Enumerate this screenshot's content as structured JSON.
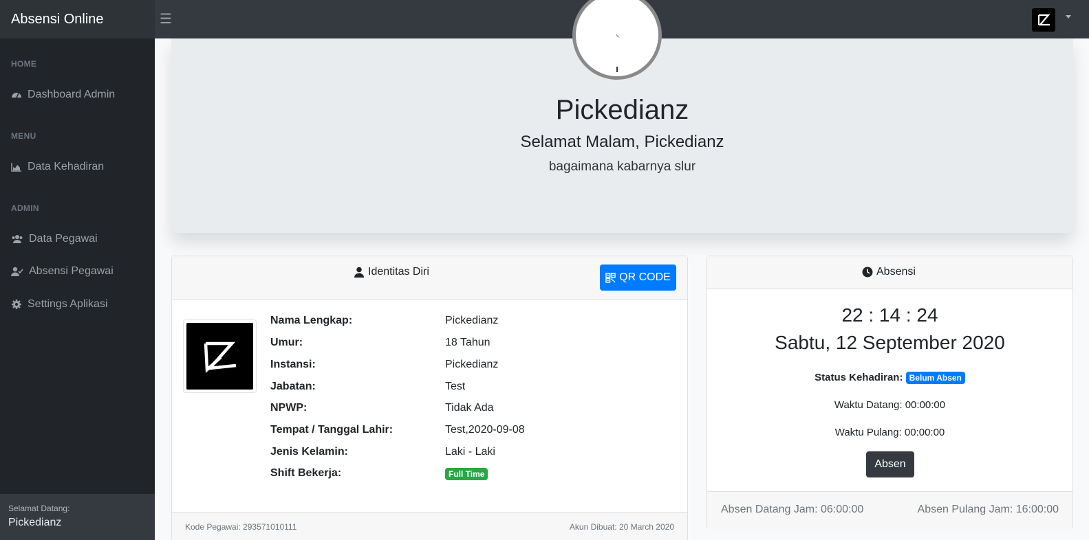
{
  "app": {
    "brand": "Absensi Online"
  },
  "sidebar": {
    "headings": [
      "HOME",
      "MENU",
      "ADMIN"
    ],
    "items": [
      {
        "label": "Dashboard Admin",
        "icon": "dashboard-icon"
      },
      {
        "label": "Data Kehadiran",
        "icon": "area-chart-icon"
      },
      {
        "label": "Data Pegawai",
        "icon": "users-icon"
      },
      {
        "label": "Absensi Pegawai",
        "icon": "user-check-icon"
      },
      {
        "label": "Settings Aplikasi",
        "icon": "gear-icon"
      }
    ],
    "footer": {
      "greeting": "Selamat Datang:",
      "name": "Pickedianz"
    }
  },
  "jumbotron": {
    "title": "Pickedianz",
    "subtitle": "Selamat Malam, Pickedianz",
    "message": "bagaimana kabarnya slur"
  },
  "identity": {
    "header": "Identitas Diri",
    "qr_button": "QR CODE",
    "rows": [
      {
        "label": "Nama Lengkap:",
        "value": "Pickedianz"
      },
      {
        "label": "Umur:",
        "value": "18 Tahun"
      },
      {
        "label": "Instansi:",
        "value": "Pickedianz"
      },
      {
        "label": "Jabatan:",
        "value": "Test"
      },
      {
        "label": "NPWP:",
        "value": "Tidak Ada"
      },
      {
        "label": "Tempat / Tanggal Lahir:",
        "value": "Test,2020-09-08"
      },
      {
        "label": "Jenis Kelamin:",
        "value": "Laki - Laki"
      },
      {
        "label": "Shift Bekerja:",
        "value": "Full Time"
      }
    ],
    "footer_left": "Kode Pegawai: 293571010111",
    "footer_right": "Akun Dibuat: 20 March 2020"
  },
  "absensi": {
    "header": "Absensi",
    "time": "22 : 14 : 24",
    "date": "Sabtu, 12 September 2020",
    "status_label": "Status Kehadiran:",
    "status_badge": "Belum Absen",
    "waktu_datang": "Waktu Datang: 00:00:00",
    "waktu_pulang": "Waktu Pulang: 00:00:00",
    "button": "Absen",
    "footer_left": "Absen Datang Jam: 06:00:00",
    "footer_right": "Absen Pulang Jam: 16:00:00"
  },
  "colors": {
    "primary": "#007bff",
    "success": "#28a745",
    "dark": "#343a40",
    "sidebar": "#212529"
  }
}
